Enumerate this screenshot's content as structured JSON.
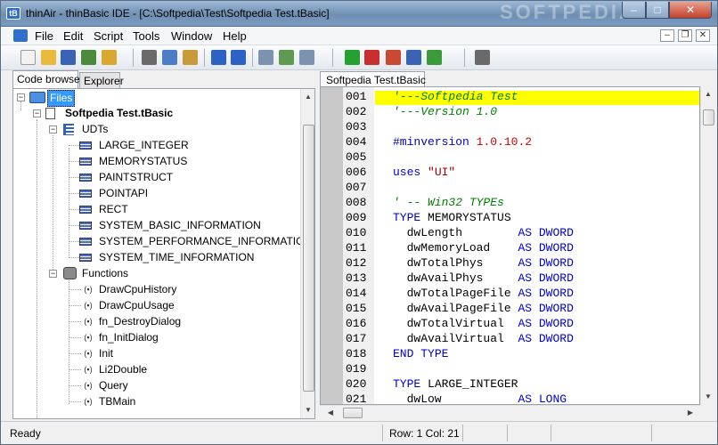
{
  "window": {
    "title": "thinAir - thinBasic IDE - [C:\\Softpedia\\Test\\Softpedia Test.tBasic]",
    "watermark": "SOFTPEDIA",
    "app_icon_text": "tB",
    "min_glyph": "–",
    "max_glyph": "□",
    "close_glyph": "✕"
  },
  "menu": {
    "items": [
      "File",
      "Edit",
      "Script",
      "Tools",
      "Window",
      "Help"
    ],
    "mdi_min": "–",
    "mdi_restore": "❐",
    "mdi_close": "✕"
  },
  "toolbar": {
    "buttons": [
      {
        "name": "new-file-icon",
        "color": "#f2f2f2"
      },
      {
        "name": "open-folder-icon",
        "color": "#e8b93a"
      },
      {
        "name": "save-icon",
        "color": "#3a62b5"
      },
      {
        "name": "save-all-icon",
        "color": "#4a8a3a"
      },
      {
        "name": "print-icon",
        "color": "#d8a830"
      },
      {
        "name": "cut-icon",
        "color": "#6a6a6a"
      },
      {
        "name": "copy-icon",
        "color": "#4e7dc8"
      },
      {
        "name": "paste-icon",
        "color": "#c89a3a"
      },
      {
        "name": "undo-icon",
        "color": "#2d62c5"
      },
      {
        "name": "redo-icon",
        "color": "#2d62c5"
      },
      {
        "name": "find-icon",
        "color": "#7b93b1"
      },
      {
        "name": "find-next-icon",
        "color": "#5f9a52"
      },
      {
        "name": "replace-icon",
        "color": "#7b93b1"
      },
      {
        "name": "run-icon",
        "color": "#26a030"
      },
      {
        "name": "debug-run-icon",
        "color": "#c83030"
      },
      {
        "name": "bundle-icon",
        "color": "#c84a30"
      },
      {
        "name": "obfuscate-icon",
        "color": "#3a62b5"
      },
      {
        "name": "compile-icon",
        "color": "#3a9a3a"
      },
      {
        "name": "options-icon",
        "color": "#6a6a6a"
      }
    ]
  },
  "left_panel": {
    "tabs": [
      "Code browser",
      "Explorer"
    ],
    "tree": {
      "root": "Files",
      "file": "Softpedia Test.tBasic",
      "udts_label": "UDTs",
      "udts": [
        "LARGE_INTEGER",
        "MEMORYSTATUS",
        "PAINTSTRUCT",
        "POINTAPI",
        "RECT",
        "SYSTEM_BASIC_INFORMATION",
        "SYSTEM_PERFORMANCE_INFORMATION",
        "SYSTEM_TIME_INFORMATION"
      ],
      "functions_label": "Functions",
      "functions": [
        "DrawCpuHistory",
        "DrawCpuUsage",
        "fn_DestroyDialog",
        "fn_InitDialog",
        "Init",
        "Li2Double",
        "Query",
        "TBMain"
      ]
    }
  },
  "editor": {
    "tab_label": "Softpedia Test.tBasic",
    "highlight_color": "#ffff00",
    "lines": [
      {
        "n": "001",
        "text": "'---Softpedia Test"
      },
      {
        "n": "002",
        "text": "'---Version 1.0"
      },
      {
        "n": "003",
        "text": ""
      },
      {
        "n": "004",
        "text": "#minversion 1.0.10.2"
      },
      {
        "n": "005",
        "text": ""
      },
      {
        "n": "006",
        "text": "uses \"UI\""
      },
      {
        "n": "007",
        "text": ""
      },
      {
        "n": "008",
        "text": "' -- Win32 TYPEs"
      },
      {
        "n": "009",
        "text": "TYPE MEMORYSTATUS"
      },
      {
        "n": "010",
        "text": "  dwLength        AS DWORD"
      },
      {
        "n": "011",
        "text": "  dwMemoryLoad    AS DWORD"
      },
      {
        "n": "012",
        "text": "  dwTotalPhys     AS DWORD"
      },
      {
        "n": "013",
        "text": "  dwAvailPhys     AS DWORD"
      },
      {
        "n": "014",
        "text": "  dwTotalPageFile AS DWORD"
      },
      {
        "n": "015",
        "text": "  dwAvailPageFile AS DWORD"
      },
      {
        "n": "016",
        "text": "  dwTotalVirtual  AS DWORD"
      },
      {
        "n": "017",
        "text": "  dwAvailVirtual  AS DWORD"
      },
      {
        "n": "018",
        "text": "END TYPE"
      },
      {
        "n": "019",
        "text": ""
      },
      {
        "n": "020",
        "text": "TYPE LARGE_INTEGER"
      },
      {
        "n": "021",
        "text": "  dwLow           AS LONG"
      }
    ]
  },
  "statusbar": {
    "state": "Ready",
    "row_col": "Row: 1  Col: 21"
  }
}
